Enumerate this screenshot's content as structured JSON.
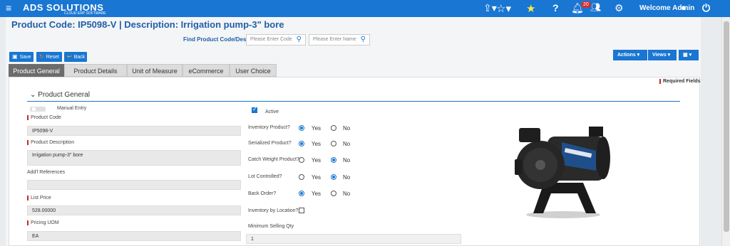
{
  "topbar": {
    "logo_main": "ADS SOLUTIONS",
    "logo_sub": "CLOUD ERP SOFTWARE",
    "notifications_count": "20",
    "welcome": "Welcome Admin"
  },
  "header": {
    "title": "Product Code:  IP5098-V | Description: Irrigation pump-3\" bore",
    "find_label": "Find Product Code/Desc",
    "code_placeholder": "Please Enter Code",
    "name_placeholder": "Please Enter Name"
  },
  "toolbar": {
    "save": "Save",
    "reset": "Reset",
    "back": "Back",
    "actions": "Actions ▾",
    "views": "Views ▾",
    "grid": "▾"
  },
  "tabs": [
    "Product General",
    "Product Details",
    "Unit of Measure",
    "eCommerce",
    "User Choice"
  ],
  "section": {
    "title": "Product General",
    "required": "Required Fields"
  },
  "form": {
    "manual_entry": "Manual Entry",
    "product_code_label": "Product Code",
    "product_code": "IP5098-V",
    "product_desc_label": "Product Description",
    "product_desc": "Irrigation pump-3\" bore",
    "addl_refs_label": "Add'l References",
    "addl_refs": "",
    "list_price_label": "List Price",
    "list_price": "528.00000",
    "pricing_uom_label": "Pricing UOM",
    "pricing_uom": "EA",
    "active_label": "Active",
    "inventory_label": "Inventory Product?",
    "serialized_label": "Serialized Product?",
    "catch_weight_label": "Catch Weight Product?",
    "lot_controlled_label": "Lot Controlled?",
    "back_order_label": "Back Order?",
    "inv_by_location_label": "Inventory by Location?",
    "min_sell_label": "Minimum Selling Qty",
    "min_sell": "1",
    "yes": "Yes",
    "no": "No"
  }
}
